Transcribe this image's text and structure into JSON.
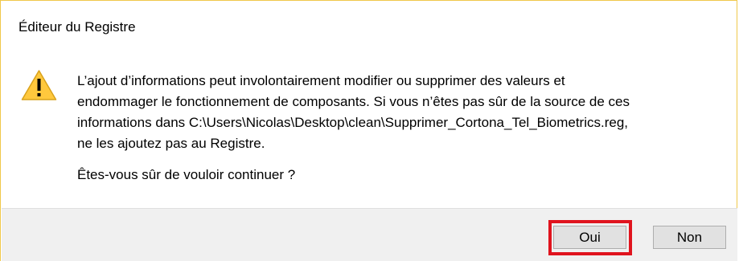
{
  "dialog": {
    "title": "Éditeur du Registre",
    "icon": "warning-icon",
    "message_lines": [
      "L’ajout d’informations peut involontairement modifier ou supprimer des valeurs et",
      "endommager le fonctionnement de composants. Si vous n’êtes pas sûr de la source de ces",
      "informations dans C:\\Users\\Nicolas\\Desktop\\clean\\Supprimer_Cortona_Tel_Biometrics.reg,",
      "ne les ajoutez pas au Registre."
    ],
    "question": "Êtes-vous sûr de vouloir continuer ?",
    "buttons": {
      "yes_label": "Oui",
      "no_label": "Non"
    },
    "highlight_color": "#e0141e",
    "border_color": "#f0c84a",
    "warning_color": "#ffc83d"
  }
}
